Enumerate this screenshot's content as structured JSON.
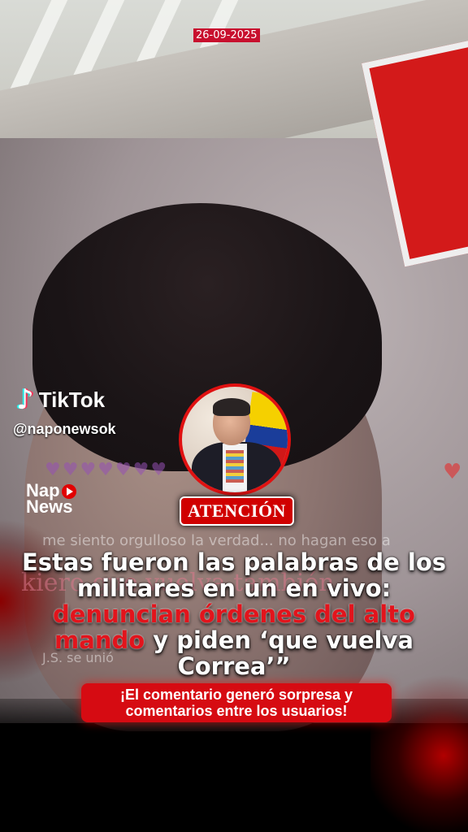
{
  "overlay": {
    "date": "26-09-2025",
    "platform": "TikTok",
    "handle": "@naponewsok",
    "logo_line1": "Nap",
    "logo_line2": "News",
    "badge": "ATENCIÓN"
  },
  "background_chat": {
    "line1": "me siento orgulloso la verdad... no hagan eso a",
    "line2": "kiero que vuelva también",
    "line3": "J.S. se unió"
  },
  "headline": {
    "part1": "Estas fueron las palabras de los militares en un en vivo: ",
    "part2_red": "denuncian órdenes del alto mando",
    "part3": " y piden ‘que vuelva Correa’”"
  },
  "subheadline": "¡El comentario generó sorpresa y comentarios entre los usuarios!",
  "colors": {
    "accent_red": "#d60b12",
    "badge_red": "#d00000",
    "text": "#ffffff"
  },
  "icons": [
    "tiktok-logo-icon",
    "play-icon",
    "heart-icon"
  ]
}
